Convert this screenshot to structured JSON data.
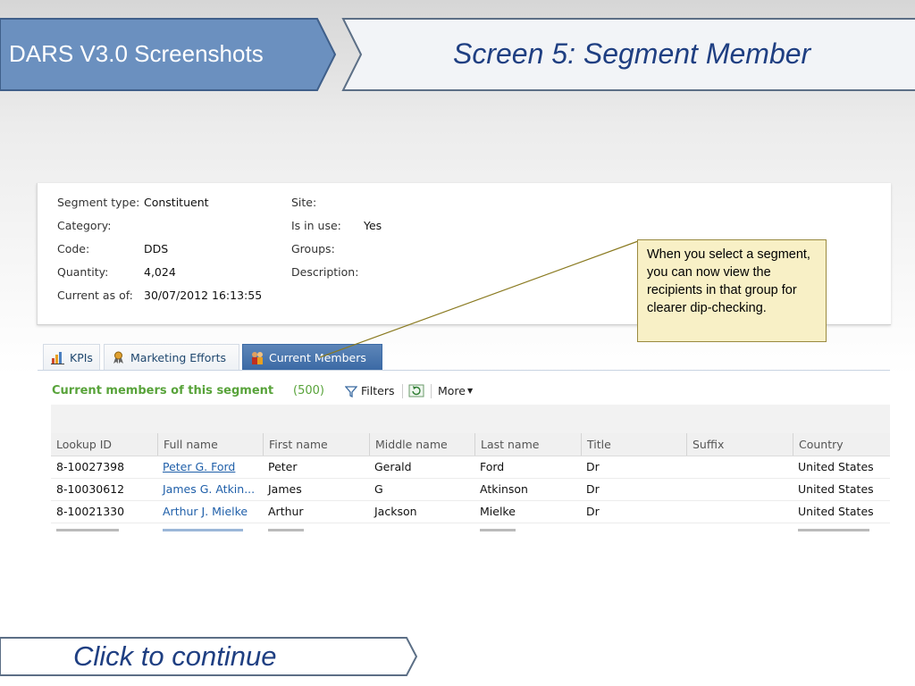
{
  "header": {
    "left_title": "DARS V3.0 Screenshots",
    "right_title": "Screen 5: Segment Member"
  },
  "segment": {
    "left": [
      {
        "label": "Segment type:",
        "value": "Constituent"
      },
      {
        "label": "Category:",
        "value": ""
      },
      {
        "label": "Code:",
        "value": "DDS"
      },
      {
        "label": "Quantity:",
        "value": "4,024"
      },
      {
        "label": "Current as of:",
        "value": "30/07/2012 16:13:55"
      }
    ],
    "right": [
      {
        "label": "Site:",
        "value": ""
      },
      {
        "label": "Is in use:",
        "value": "Yes"
      },
      {
        "label": "Groups:",
        "value": ""
      },
      {
        "label": "Description:",
        "value": ""
      }
    ]
  },
  "tabs": [
    {
      "label": "KPIs",
      "icon": "kpi-chart-icon",
      "active": false
    },
    {
      "label": "Marketing Efforts",
      "icon": "marketing-ribbon-icon",
      "active": false
    },
    {
      "label": "Current Members",
      "icon": "members-icon",
      "active": true
    }
  ],
  "members": {
    "title": "Current members of this segment",
    "count": "(500)",
    "filters_label": "Filters",
    "more_label": "More",
    "columns": [
      "Lookup ID",
      "Full name",
      "First name",
      "Middle name",
      "Last name",
      "Title",
      "Suffix",
      "Country"
    ],
    "rows": [
      [
        "8-10027398",
        "Peter G. Ford",
        "Peter",
        "Gerald",
        "Ford",
        "Dr",
        "",
        "United States"
      ],
      [
        "8-10030612",
        "James G. Atkin...",
        "James",
        "G",
        "Atkinson",
        "Dr",
        "",
        "United States"
      ],
      [
        "8-10021330",
        "Arthur J. Mielke",
        "Arthur",
        "Jackson",
        "Mielke",
        "Dr",
        "",
        "United States"
      ]
    ]
  },
  "callout": {
    "text": "When you select a segment, you can now view the recipients in that group for clearer dip-checking."
  },
  "footer": {
    "continue_label": "Click to continue"
  },
  "colors": {
    "left_title_bg": "#6b90bf",
    "title_text": "#1f3f82",
    "callout_bg": "#f8f0c6",
    "section_green": "#58a33a",
    "active_tab": "#3b6aa5"
  }
}
